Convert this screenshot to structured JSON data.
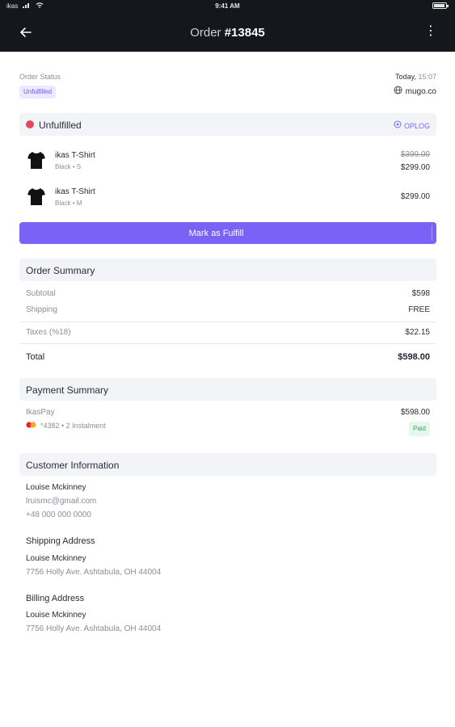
{
  "status_bar": {
    "carrier": "ikas",
    "time": "9:41 AM"
  },
  "header": {
    "title_prefix": "Order",
    "order_number": "#13845"
  },
  "order_status": {
    "label": "Order Status",
    "badge": "Unfulfilled",
    "date": "Today,",
    "time": "15:07",
    "domain": "mugo.co"
  },
  "fulfillment": {
    "title": "Unfulfilled",
    "oplog": "OPLOG",
    "items": [
      {
        "name": "ikas T-Shirt",
        "variant": "Black • S",
        "old_price": "$399.00",
        "price": "$299.00"
      },
      {
        "name": "ikas T-Shirt",
        "variant": "Black • M",
        "price": "$299.00"
      }
    ],
    "button": "Mark as Fulfill"
  },
  "order_summary": {
    "title": "Order Summary",
    "subtotal_label": "Subtotal",
    "subtotal": "$598",
    "shipping_label": "Shipping",
    "shipping": "FREE",
    "taxes_label": "Taxes (%18)",
    "taxes": "$22.15",
    "total_label": "Total",
    "total": "$598.00"
  },
  "payment_summary": {
    "title": "Payment Summary",
    "method": "IkasPay",
    "amount": "$598.00",
    "card": "*4382 • 2 Instalment",
    "status": "Paid"
  },
  "customer": {
    "title": "Customer Information",
    "name": "Louise Mckinney",
    "email": "lruismc@gmail.com",
    "phone": "+48 000 000 0000",
    "shipping_title": "Shipping Address",
    "shipping_name": "Louise Mckinney",
    "shipping_address": "7756 Holly Ave. Ashtabula, OH 44004",
    "billing_title": "Billing Address",
    "billing_name": "Louise Mckinney",
    "billing_address": "7756 Holly Ave. Ashtabula, OH 44004"
  },
  "colors": {
    "accent": "#7a62f6",
    "header_bg": "#16171d",
    "alert": "#e24a5d",
    "success": "#31a85a"
  }
}
